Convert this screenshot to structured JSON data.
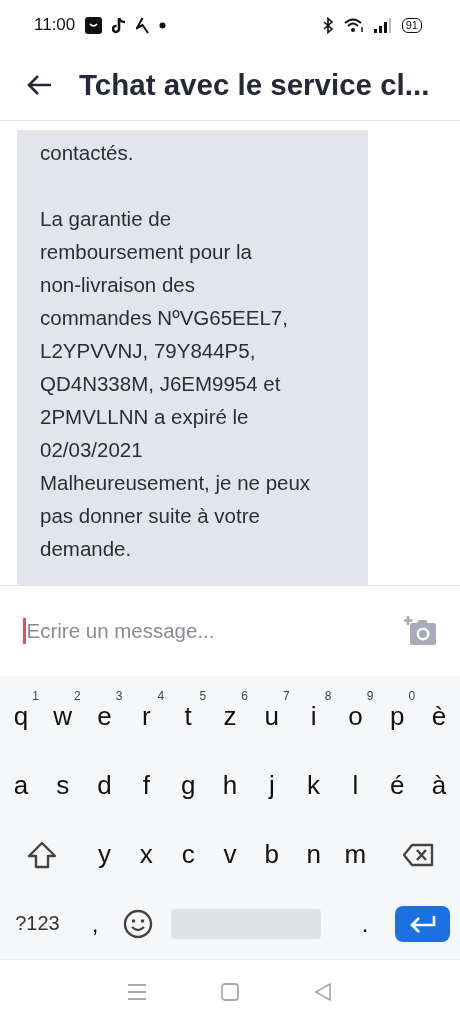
{
  "status_bar": {
    "time": "11:00",
    "battery": "91"
  },
  "header": {
    "title": "Tchat avec le service cl..."
  },
  "messages": [
    {
      "paragraphs": [
        "contactés.",
        "La garantie de\nremboursement pour la\nnon-livraison des\ncommandes NºVG65EEL7,\nL2YPVVNJ, 79Y844P5,\nQD4N338M, J6EM9954 et\n2PMVLLNN a expiré le\n02/03/2021\nMalheureusement, je ne peux\npas donner suite à votre\ndemande."
      ]
    }
  ],
  "composer": {
    "placeholder": "Ecrire un message..."
  },
  "keyboard": {
    "rows": [
      {
        "keys": [
          {
            "kind": "letter",
            "label": "q",
            "hint": "1"
          },
          {
            "kind": "letter",
            "label": "w",
            "hint": "2"
          },
          {
            "kind": "letter",
            "label": "e",
            "hint": "3"
          },
          {
            "kind": "letter",
            "label": "r",
            "hint": "4"
          },
          {
            "kind": "letter",
            "label": "t",
            "hint": "5"
          },
          {
            "kind": "letter",
            "label": "z",
            "hint": "6"
          },
          {
            "kind": "letter",
            "label": "u",
            "hint": "7"
          },
          {
            "kind": "letter",
            "label": "i",
            "hint": "8"
          },
          {
            "kind": "letter",
            "label": "o",
            "hint": "9"
          },
          {
            "kind": "letter",
            "label": "p",
            "hint": "0"
          },
          {
            "kind": "letter",
            "label": "è"
          }
        ]
      },
      {
        "keys": [
          {
            "kind": "letter",
            "label": "a"
          },
          {
            "kind": "letter",
            "label": "s"
          },
          {
            "kind": "letter",
            "label": "d"
          },
          {
            "kind": "letter",
            "label": "f"
          },
          {
            "kind": "letter",
            "label": "g"
          },
          {
            "kind": "letter",
            "label": "h"
          },
          {
            "kind": "letter",
            "label": "j"
          },
          {
            "kind": "letter",
            "label": "k"
          },
          {
            "kind": "letter",
            "label": "l"
          },
          {
            "kind": "letter",
            "label": "é"
          },
          {
            "kind": "letter",
            "label": "à"
          }
        ]
      },
      {
        "keys": [
          {
            "kind": "shift"
          },
          {
            "kind": "letter",
            "label": "y"
          },
          {
            "kind": "letter",
            "label": "x"
          },
          {
            "kind": "letter",
            "label": "c"
          },
          {
            "kind": "letter",
            "label": "v"
          },
          {
            "kind": "letter",
            "label": "b"
          },
          {
            "kind": "letter",
            "label": "n"
          },
          {
            "kind": "letter",
            "label": "m"
          },
          {
            "kind": "backspace"
          }
        ]
      },
      {
        "keys": [
          {
            "kind": "symbols",
            "label": "?123"
          },
          {
            "kind": "punct",
            "label": ","
          },
          {
            "kind": "emoji"
          },
          {
            "kind": "space"
          },
          {
            "kind": "punct",
            "label": "."
          },
          {
            "kind": "enter"
          }
        ]
      }
    ]
  }
}
